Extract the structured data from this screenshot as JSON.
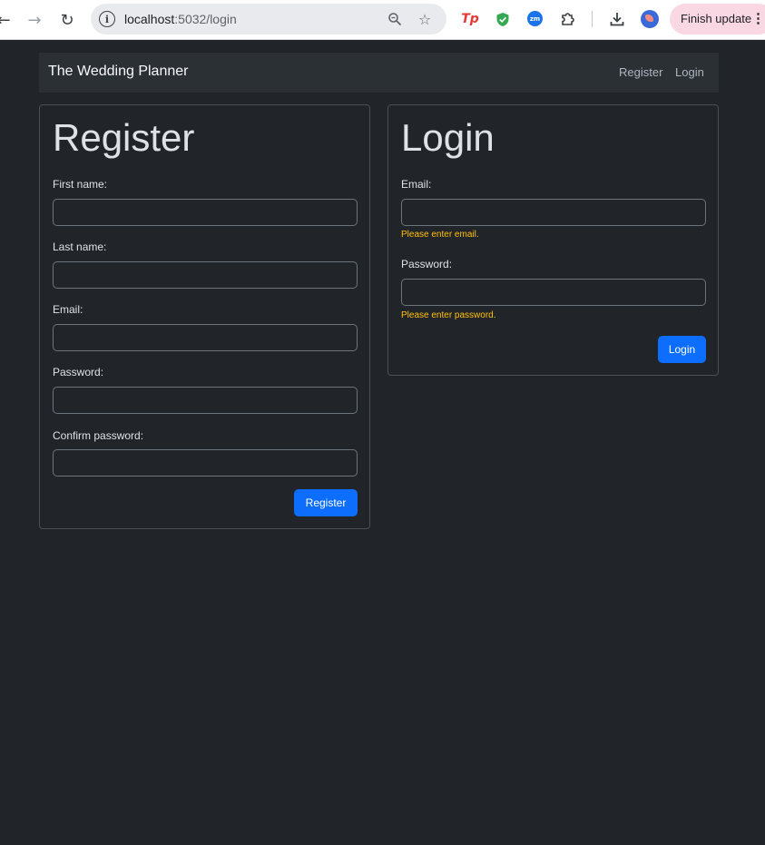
{
  "browser": {
    "url_host": "localhost",
    "url_path": ":5032/login",
    "finish_update_label": "Finish update",
    "ext_tp_label": "Tp",
    "ext_zm_label": "zm"
  },
  "navbar": {
    "brand": "The Wedding Planner",
    "links": [
      "Register",
      "Login"
    ]
  },
  "register": {
    "title": "Register",
    "fields": [
      {
        "label": "First name:",
        "value": ""
      },
      {
        "label": "Last name:",
        "value": ""
      },
      {
        "label": "Email:",
        "value": ""
      },
      {
        "label": "Password:",
        "value": ""
      },
      {
        "label": "Confirm password:",
        "value": ""
      }
    ],
    "submit_label": "Register"
  },
  "login": {
    "title": "Login",
    "fields": [
      {
        "label": "Email:",
        "value": "",
        "error": "Please enter email."
      },
      {
        "label": "Password:",
        "value": "",
        "error": "Please enter password."
      }
    ],
    "submit_label": "Login"
  },
  "colors": {
    "background": "#212529",
    "primary": "#0d6efd",
    "warning": "#ffc107"
  }
}
